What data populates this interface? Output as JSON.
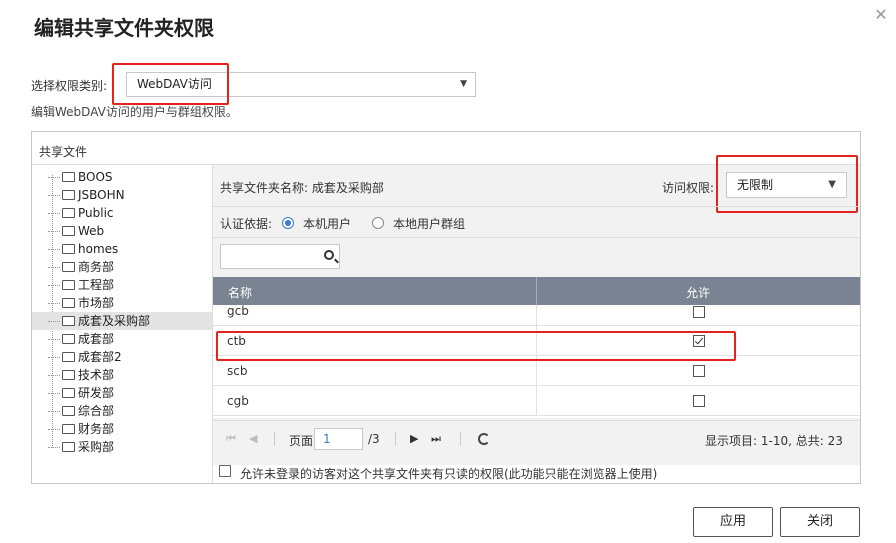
{
  "dialog": {
    "title": "编辑共享文件夹权限",
    "close_icon": "close-icon"
  },
  "permission_type": {
    "label": "选择权限类别:",
    "selected": "WebDAV访问",
    "description": "编辑WebDAV访问的用户与群组权限。"
  },
  "panel": {
    "header": "共享文件"
  },
  "tree": {
    "items": [
      "BOOS",
      "JSBOHN",
      "Public",
      "Web",
      "homes",
      "商务部",
      "工程部",
      "市场部",
      "成套及采购部",
      "成套部",
      "成套部2",
      "技术部",
      "研发部",
      "综合部",
      "财务部",
      "采购部"
    ],
    "selected_index": 8
  },
  "folder_info": {
    "name_label": "共享文件夹名称: 成套及采购部",
    "access_label": "访问权限:",
    "access_value": "无限制"
  },
  "auth": {
    "label": "认证依据:",
    "options": [
      "本机用户",
      "本地用户群组"
    ],
    "selected_index": 0
  },
  "search": {
    "placeholder": "",
    "icon": "search-icon"
  },
  "grid": {
    "columns": [
      "名称",
      "允许"
    ],
    "rows": [
      {
        "name": "gcb",
        "allowed": false
      },
      {
        "name": "ctb",
        "allowed": true
      },
      {
        "name": "scb",
        "allowed": false
      },
      {
        "name": "cgb",
        "allowed": false
      }
    ]
  },
  "pager": {
    "page_label": "页面",
    "page_value": "1",
    "total_pages": "/3",
    "summary": "显示项目: 1-10, 总共: 23"
  },
  "anonymous": {
    "label": "允许未登录的访客对这个共享文件夹有只读的权限(此功能只能在浏览器上使用)"
  },
  "buttons": {
    "apply": "应用",
    "close": "关闭"
  },
  "colors": {
    "highlight": "#e3231d",
    "grid_header": "#7a8391",
    "selection": "#e4e4e4",
    "accent": "#3a7bd5"
  }
}
